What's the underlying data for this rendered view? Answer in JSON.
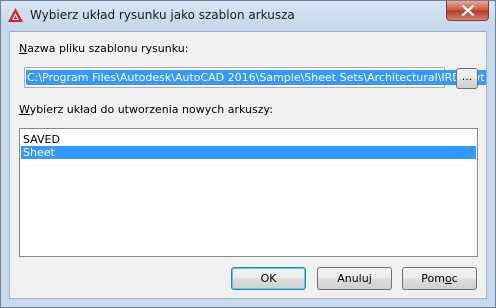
{
  "window": {
    "title": "Wybierz układ rysunku jako szablon arkusza"
  },
  "template_file": {
    "label_underlined": "N",
    "label_rest": "azwa pliku szablonu rysunku:",
    "path_value": "C:\\Program Files\\Autodesk\\AutoCAD 2016\\Sample\\Sheet Sets\\Architectural\\IRD.dwt",
    "browse_label": "..."
  },
  "layout_list": {
    "label_underlined": "W",
    "label_rest": "ybierz układ do utworzenia nowych arkuszy:",
    "items": [
      {
        "label": "SAVED",
        "selected": false
      },
      {
        "label": "Sheet",
        "selected": true
      }
    ]
  },
  "buttons": {
    "ok": "OK",
    "cancel": "Anuluj",
    "help_pre": "Pom",
    "help_underlined": "o",
    "help_post": "c"
  },
  "colors": {
    "selection": "#3399ff",
    "close_button": "#c8523a",
    "titlebar": "#c9d9ec"
  },
  "icons": {
    "app": "autocad-logo-icon",
    "close": "close-icon"
  }
}
